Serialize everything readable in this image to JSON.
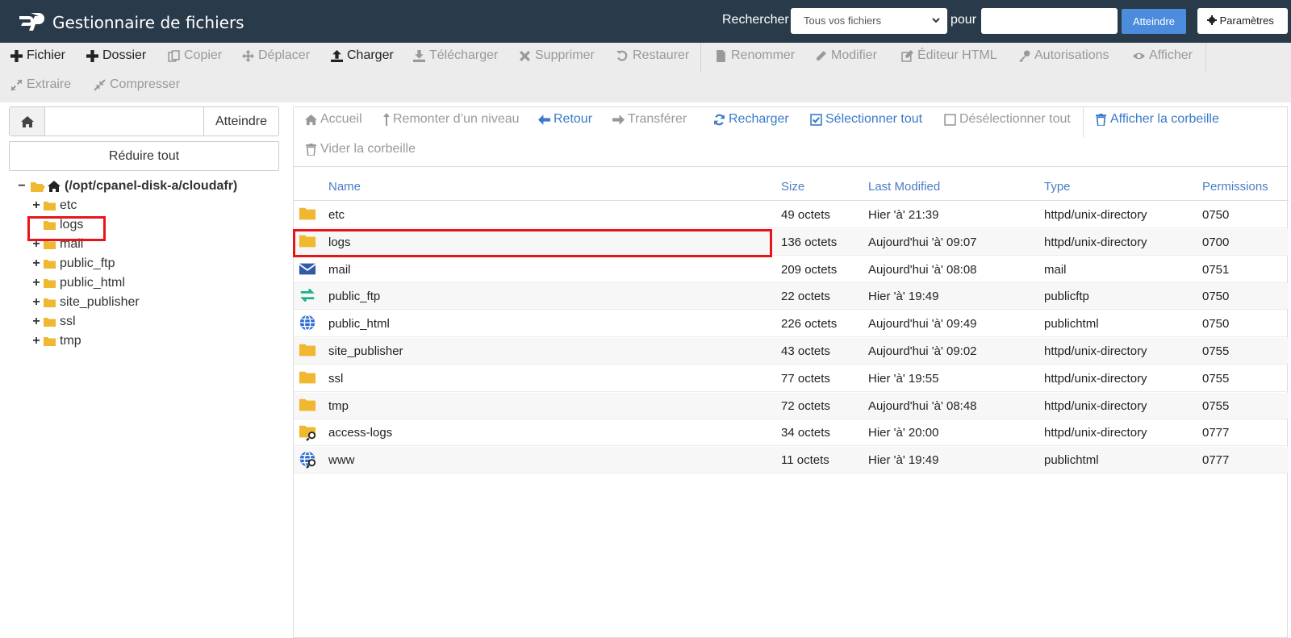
{
  "header": {
    "title": "Gestionnaire de fichiers",
    "search_label": "Rechercher",
    "search_scope": "Tous vos fichiers",
    "for_label": "pour",
    "search_value": "",
    "go_label": "Atteindre",
    "settings_label": "Paramètres"
  },
  "toolbar": {
    "file": "Fichier",
    "folder": "Dossier",
    "copy": "Copier",
    "move": "Déplacer",
    "upload": "Charger",
    "download": "Télécharger",
    "delete": "Supprimer",
    "restore": "Restaurer",
    "rename": "Renommer",
    "edit": "Modifier",
    "html_editor": "Éditeur HTML",
    "permissions": "Autorisations",
    "view": "Afficher",
    "extract": "Extraire",
    "compress": "Compresser"
  },
  "sidebar": {
    "path_value": "",
    "go_label": "Atteindre",
    "collapse_label": "Réduire tout",
    "root": "(/opt/cpanel-disk-a/cloudafr)",
    "folders": [
      {
        "name": "etc",
        "expandable": true
      },
      {
        "name": "logs",
        "expandable": false
      },
      {
        "name": "mail",
        "expandable": true
      },
      {
        "name": "public_ftp",
        "expandable": true
      },
      {
        "name": "public_html",
        "expandable": true
      },
      {
        "name": "site_publisher",
        "expandable": true
      },
      {
        "name": "ssl",
        "expandable": true
      },
      {
        "name": "tmp",
        "expandable": true
      }
    ]
  },
  "navbar": {
    "home": "Accueil",
    "up": "Remonter d’un niveau",
    "back": "Retour",
    "forward": "Transférer",
    "reload": "Recharger",
    "select_all": "Sélectionner tout",
    "deselect_all": "Désélectionner tout",
    "show_trash": "Afficher la corbeille",
    "empty_trash": "Vider la corbeille"
  },
  "table": {
    "columns": {
      "name": "Name",
      "size": "Size",
      "modified": "Last Modified",
      "type": "Type",
      "perms": "Permissions"
    },
    "rows": [
      {
        "icon": "folder",
        "name": "etc",
        "size": "49 octets",
        "modified": "Hier 'à' 21:39",
        "type": "httpd/unix-directory",
        "perms": "0750"
      },
      {
        "icon": "folder",
        "name": "logs",
        "size": "136 octets",
        "modified": "Aujourd'hui 'à' 09:07",
        "type": "httpd/unix-directory",
        "perms": "0700"
      },
      {
        "icon": "mail",
        "name": "mail",
        "size": "209 octets",
        "modified": "Aujourd'hui 'à' 08:08",
        "type": "mail",
        "perms": "0751"
      },
      {
        "icon": "ftp",
        "name": "public_ftp",
        "size": "22 octets",
        "modified": "Hier 'à' 19:49",
        "type": "publicftp",
        "perms": "0750"
      },
      {
        "icon": "globe",
        "name": "public_html",
        "size": "226 octets",
        "modified": "Aujourd'hui 'à' 09:49",
        "type": "publichtml",
        "perms": "0750"
      },
      {
        "icon": "folder",
        "name": "site_publisher",
        "size": "43 octets",
        "modified": "Aujourd'hui 'à' 09:02",
        "type": "httpd/unix-directory",
        "perms": "0755"
      },
      {
        "icon": "folder",
        "name": "ssl",
        "size": "77 octets",
        "modified": "Hier 'à' 19:55",
        "type": "httpd/unix-directory",
        "perms": "0755"
      },
      {
        "icon": "folder",
        "name": "tmp",
        "size": "72 octets",
        "modified": "Aujourd'hui 'à' 08:48",
        "type": "httpd/unix-directory",
        "perms": "0755"
      },
      {
        "icon": "folder-link",
        "name": "access-logs",
        "size": "34 octets",
        "modified": "Hier 'à' 20:00",
        "type": "httpd/unix-directory",
        "perms": "0777"
      },
      {
        "icon": "globe-link",
        "name": "www",
        "size": "11 octets",
        "modified": "Hier 'à' 19:49",
        "type": "publichtml",
        "perms": "0777"
      }
    ]
  },
  "colors": {
    "header_bg": "#293a4a",
    "accent": "#4c8cdc",
    "link": "#3a7ac8",
    "folder": "#f0b731",
    "highlight": "#e8141b"
  }
}
